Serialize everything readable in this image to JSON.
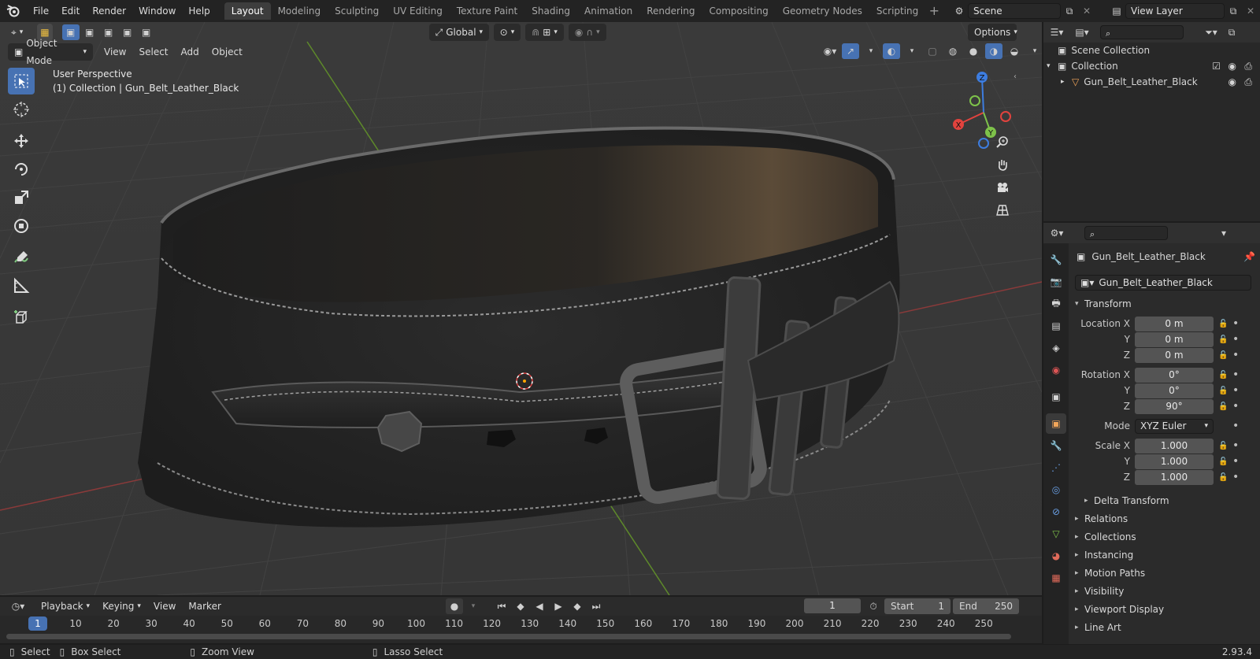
{
  "topbar": {
    "menus": [
      "File",
      "Edit",
      "Render",
      "Window",
      "Help"
    ],
    "workspaces": [
      "Layout",
      "Modeling",
      "Sculpting",
      "UV Editing",
      "Texture Paint",
      "Shading",
      "Animation",
      "Rendering",
      "Compositing",
      "Geometry Nodes",
      "Scripting"
    ],
    "active_workspace": "Layout",
    "scene": "Scene",
    "view_layer": "View Layer"
  },
  "viewport": {
    "transform_orientation": "Global",
    "options_label": "Options",
    "mode": "Object Mode",
    "menus": [
      "View",
      "Select",
      "Add",
      "Object"
    ],
    "info_line1": "User Perspective",
    "info_line2": "(1) Collection | Gun_Belt_Leather_Black",
    "gizmo_labels": {
      "x": "X",
      "y": "Y",
      "z": "Z"
    }
  },
  "outliner": {
    "scene_collection": "Scene Collection",
    "collection": "Collection",
    "object": "Gun_Belt_Leather_Black"
  },
  "properties": {
    "object_name": "Gun_Belt_Leather_Black",
    "datablock_name": "Gun_Belt_Leather_Black",
    "transform_title": "Transform",
    "location_label": "Location X",
    "location": [
      "0 m",
      "0 m",
      "0 m"
    ],
    "rotation_label": "Rotation X",
    "rotation": [
      "0°",
      "0°",
      "90°"
    ],
    "mode_label": "Mode",
    "mode_value": "XYZ Euler",
    "scale_label": "Scale X",
    "scale": [
      "1.000",
      "1.000",
      "1.000"
    ],
    "axis_y": "Y",
    "axis_z": "Z",
    "delta_transform": "Delta Transform",
    "panels": [
      "Relations",
      "Collections",
      "Instancing",
      "Motion Paths",
      "Visibility",
      "Viewport Display",
      "Line Art"
    ]
  },
  "timeline": {
    "menus": [
      "Playback",
      "Keying",
      "View",
      "Marker"
    ],
    "current_frame": "1",
    "start_label": "Start",
    "start_value": "1",
    "end_label": "End",
    "end_value": "250",
    "ruler": [
      "1",
      "10",
      "20",
      "30",
      "40",
      "50",
      "60",
      "70",
      "80",
      "90",
      "100",
      "110",
      "120",
      "130",
      "140",
      "150",
      "160",
      "170",
      "180",
      "190",
      "200",
      "210",
      "220",
      "230",
      "240",
      "250"
    ]
  },
  "statusbar": {
    "select": "Select",
    "box_select": "Box Select",
    "zoom_view": "Zoom View",
    "lasso_select": "Lasso Select",
    "version": "2.93.4"
  },
  "colors": {
    "accent": "#4772b3",
    "axis_x": "#e2433e",
    "axis_y": "#7ec24a",
    "axis_z": "#3d7de0",
    "grid_line": "#444444",
    "viewport_bg": "#393939"
  }
}
